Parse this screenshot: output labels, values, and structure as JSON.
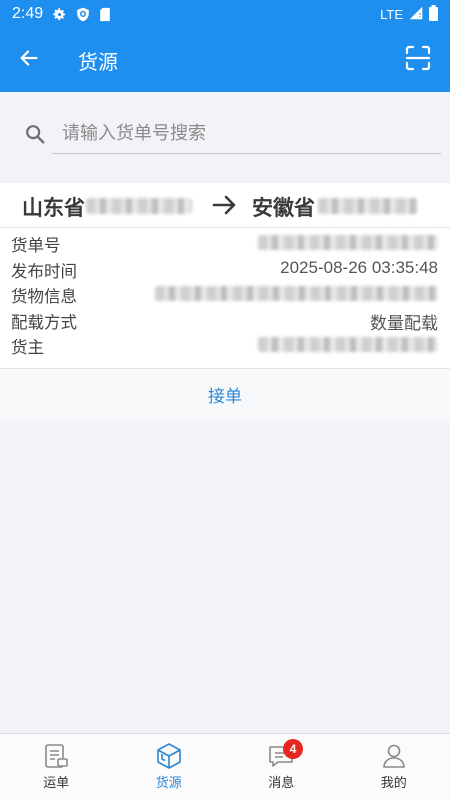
{
  "status_bar": {
    "time": "2:49",
    "network": "LTE",
    "icons": [
      "gear-icon",
      "shield-icon",
      "sd-card-icon",
      "signal-icon",
      "battery-icon"
    ]
  },
  "header": {
    "title": "货源",
    "back_icon": "arrow-left-icon",
    "scan_icon": "scan-icon"
  },
  "search": {
    "placeholder": "请输入货单号搜索",
    "value": ""
  },
  "cargo_list": [
    {
      "from": "山东省",
      "to": "安徽省",
      "fields": {
        "order_no_label": "货单号",
        "publish_time_label": "发布时间",
        "publish_time": "2025-08-26 03:35:48",
        "goods_info_label": "货物信息",
        "load_mode_label": "配载方式",
        "load_mode": "数量配载",
        "owner_label": "货主"
      },
      "accept_label": "接单"
    }
  ],
  "tabbar": {
    "items": [
      {
        "label": "运单",
        "icon": "waybill-icon",
        "active": false
      },
      {
        "label": "货源",
        "icon": "cargo-box-icon",
        "active": true
      },
      {
        "label": "消息",
        "icon": "message-icon",
        "active": false,
        "badge": "4"
      },
      {
        "label": "我的",
        "icon": "user-icon",
        "active": false
      }
    ]
  },
  "colors": {
    "primary": "#1e8fee",
    "accent_text": "#2b86d6",
    "badge": "#e8261f",
    "background": "#f2f3f7"
  }
}
